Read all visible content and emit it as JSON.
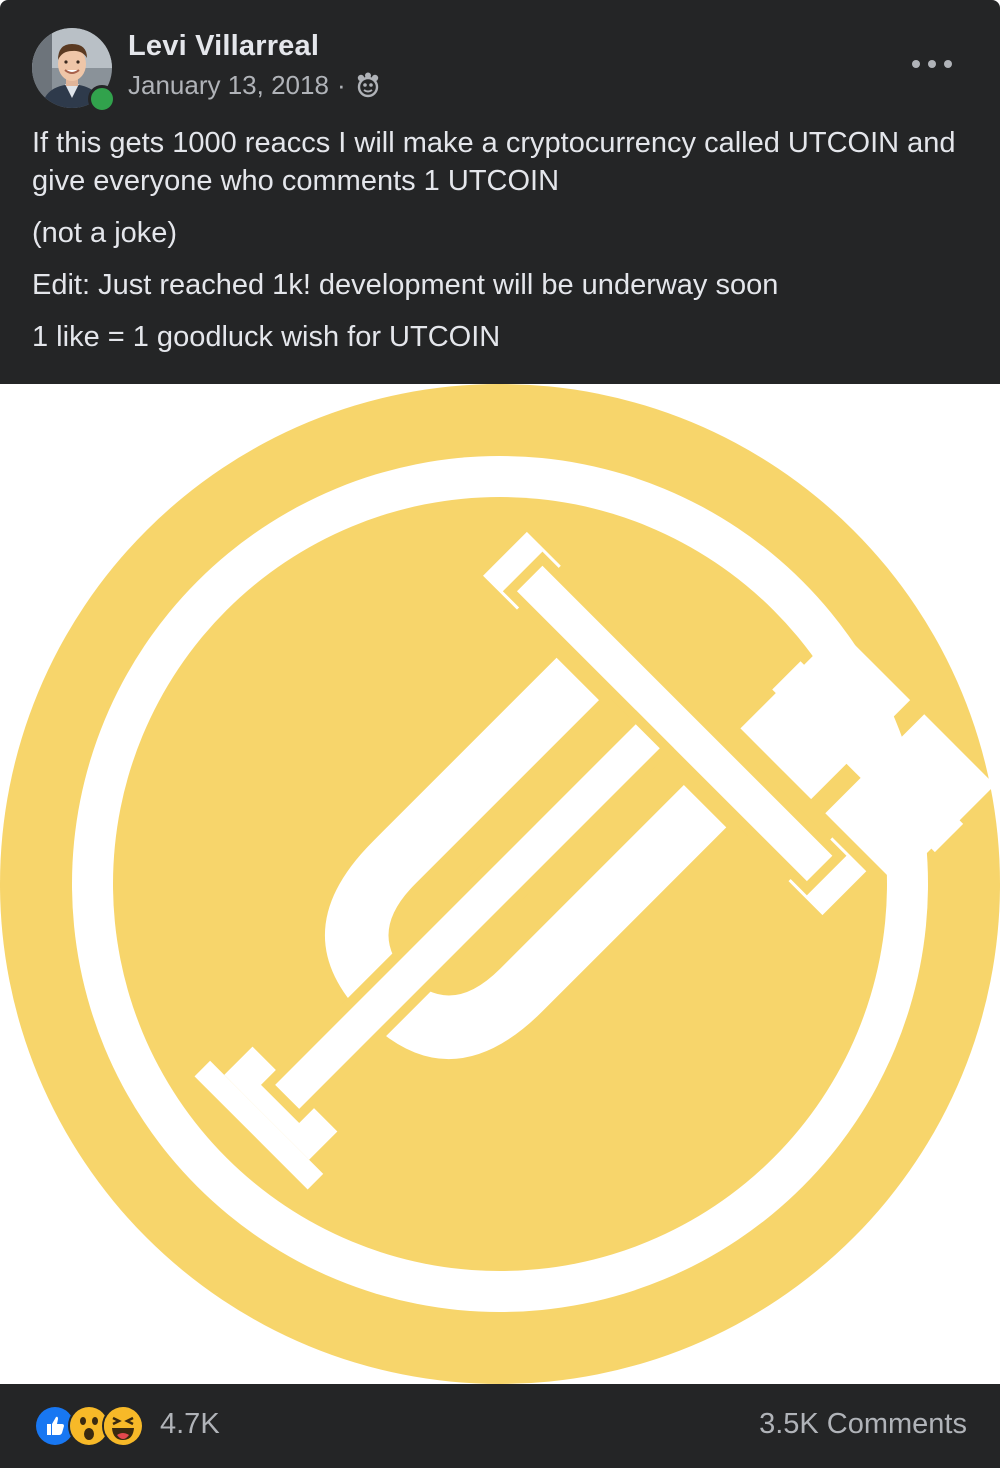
{
  "post": {
    "author": "Levi Villarreal",
    "date": "January 13, 2018",
    "separator": "·",
    "privacy_icon": "friends-of-friends-icon",
    "more_icon": "more-options-icon",
    "text": {
      "line1": "If this gets 1000 reaccs I will make a cryptocurrency called UTCOIN and give everyone who comments 1 UTCOIN",
      "line2": "(not a joke)",
      "line3": "Edit: Just reached 1k! development will be underway soon",
      "line4": "1 like = 1 goodluck wish for UTCOIN"
    },
    "image": {
      "icon": "utcoin-logo-icon",
      "coin_color": "#f7d56b",
      "background": "#ffffff"
    }
  },
  "footer": {
    "reactions": [
      "like",
      "wow",
      "haha"
    ],
    "reaction_count": "4.7K",
    "comments": "3.5K Comments"
  },
  "colors": {
    "card_bg": "#242526",
    "text_primary": "#e4e6eb",
    "text_secondary": "#b0b3b8",
    "online": "#31a24c",
    "like_blue": "#1877f2"
  }
}
